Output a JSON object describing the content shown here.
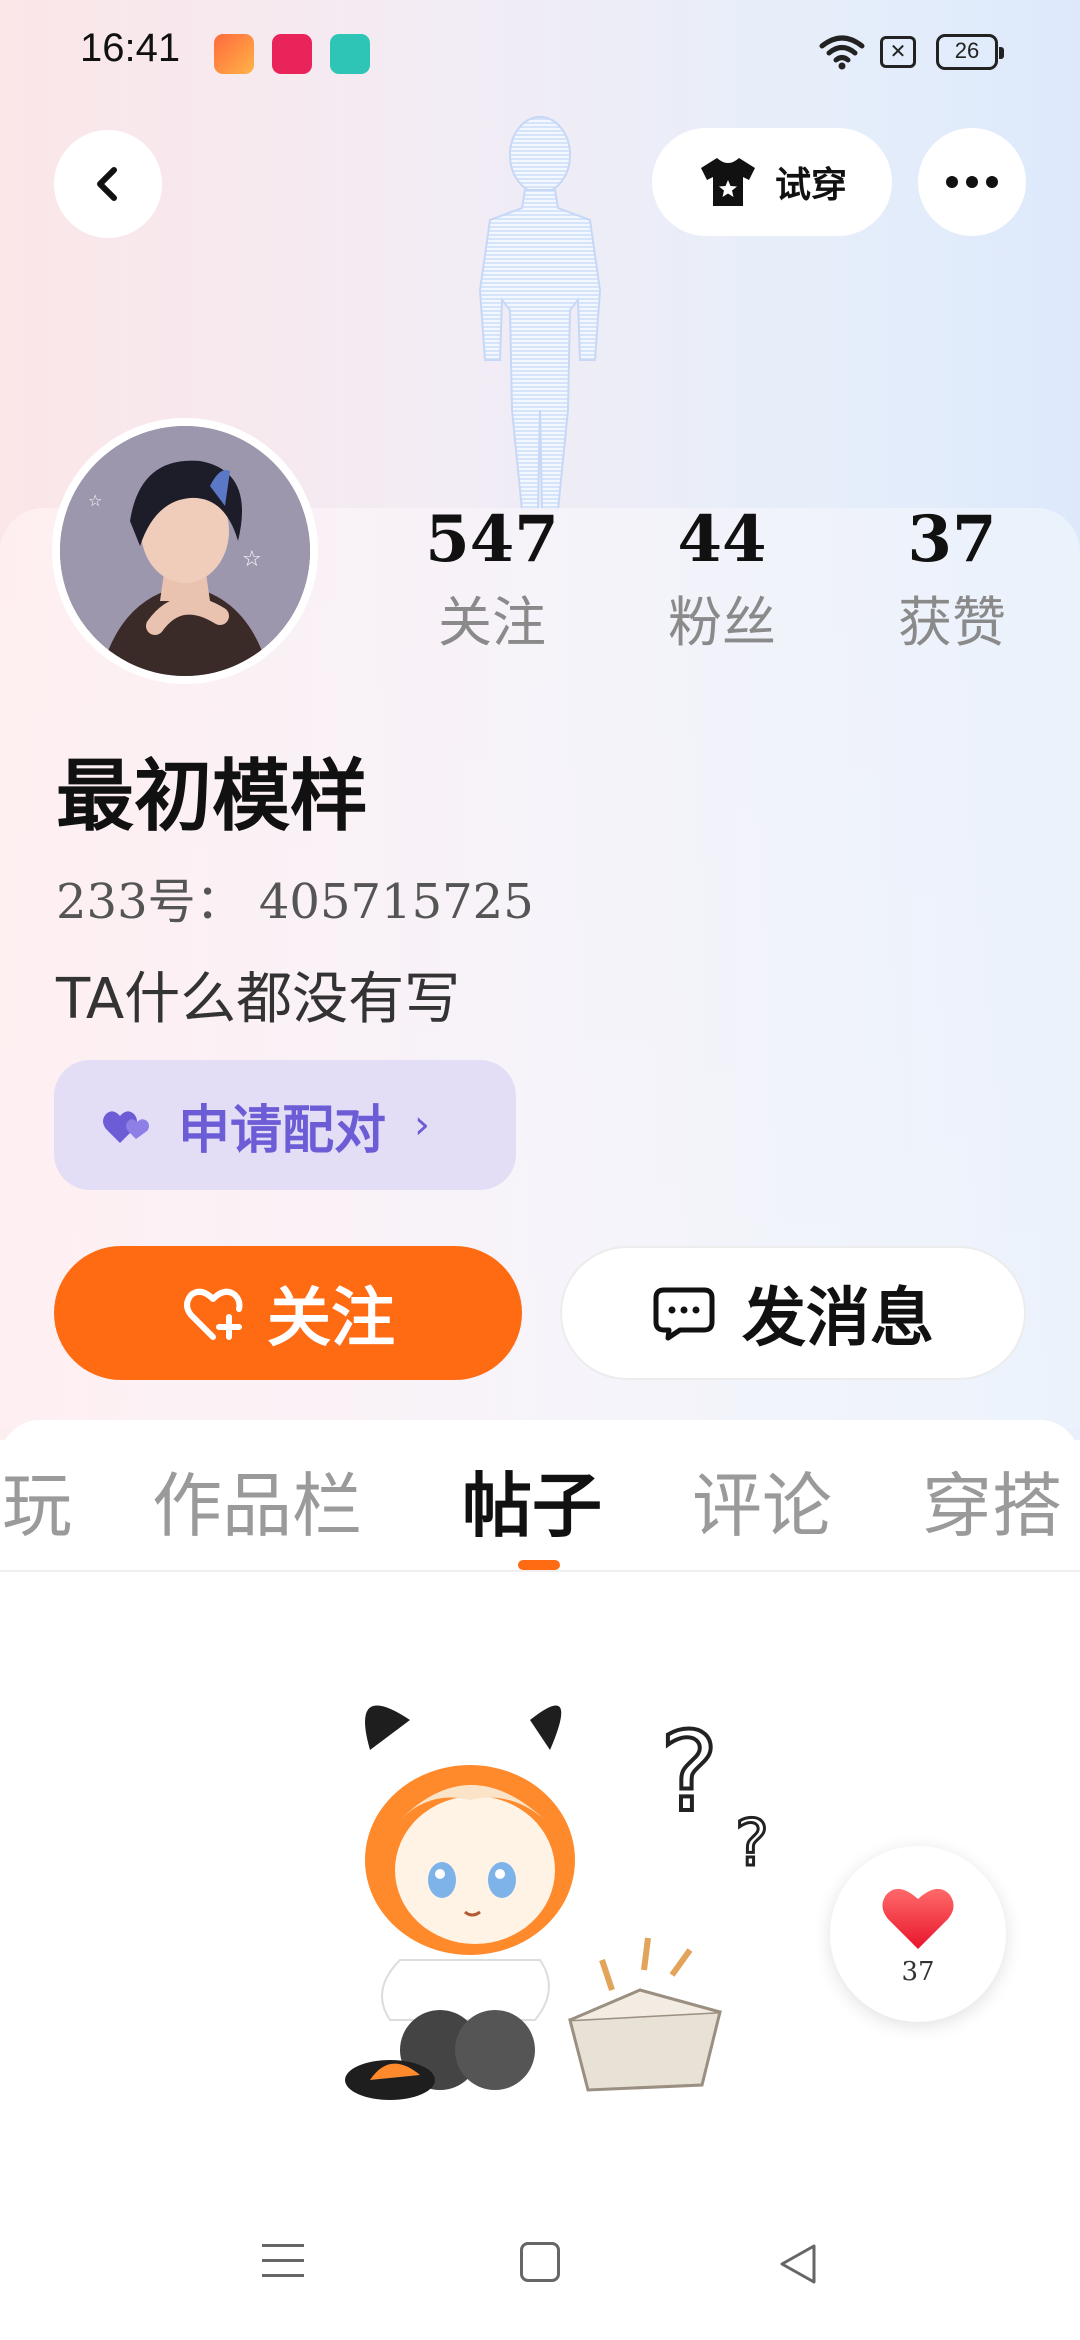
{
  "status_bar": {
    "time": "16:41",
    "battery": "26",
    "app_badges": [
      "app-icon-1",
      "app-icon-2",
      "app-icon-3"
    ]
  },
  "header": {
    "back_icon": "chevron-left-icon",
    "tryon_label": "试穿",
    "tryon_icon": "tshirt-icon",
    "more_icon": "more-dots-icon"
  },
  "profile": {
    "nickname": "最初模样",
    "id_label": "233号：",
    "id_value": "405715725",
    "bio": "TA什么都没有写",
    "stats": [
      {
        "value": "547",
        "label": "关注"
      },
      {
        "value": "44",
        "label": "粉丝"
      },
      {
        "value": "37",
        "label": "获赞"
      }
    ]
  },
  "actions": {
    "pair_label": "申请配对",
    "pair_chevron": "›",
    "follow_label": "关注",
    "message_label": "发消息"
  },
  "tabs": [
    {
      "label": "玩",
      "active": false
    },
    {
      "label": "作品栏",
      "active": false
    },
    {
      "label": "帖子",
      "active": true
    },
    {
      "label": "评论",
      "active": false
    },
    {
      "label": "穿搭",
      "active": false
    }
  ],
  "like_fab": {
    "count": "37",
    "icon": "heart-icon"
  },
  "colors": {
    "accent_orange": "#ff6b13",
    "pair_bg": "#e3def6",
    "pair_text": "#6c5cd6"
  }
}
